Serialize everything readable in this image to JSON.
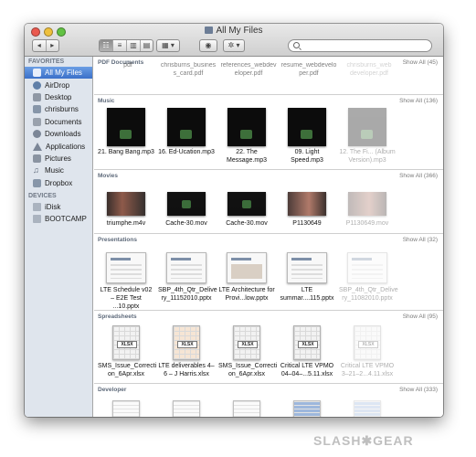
{
  "window": {
    "title": "All My Files"
  },
  "toolbar": {
    "back_forward": [
      "◂",
      "▸"
    ],
    "view_buttons": [
      "☷",
      "≡",
      "▥",
      "▤"
    ],
    "arrange_label": "▦ ▾",
    "quicklook_label": "◉",
    "action_label": "✲ ▾",
    "search_placeholder": ""
  },
  "sidebar": {
    "favorites_header": "FAVORITES",
    "favorites": [
      {
        "label": "All My Files",
        "icon": "all-files-icon",
        "selected": true
      },
      {
        "label": "AirDrop",
        "icon": "airdrop-icon"
      },
      {
        "label": "Desktop",
        "icon": "desktop-icon"
      },
      {
        "label": "chrisburns",
        "icon": "home-icon"
      },
      {
        "label": "Documents",
        "icon": "documents-icon"
      },
      {
        "label": "Downloads",
        "icon": "downloads-icon"
      },
      {
        "label": "Applications",
        "icon": "applications-icon"
      },
      {
        "label": "Pictures",
        "icon": "pictures-icon"
      },
      {
        "label": "Music",
        "icon": "music-icon"
      },
      {
        "label": "Dropbox",
        "icon": "dropbox-icon"
      }
    ],
    "devices_header": "DEVICES",
    "devices": [
      {
        "label": "iDisk",
        "icon": "idisk-icon"
      },
      {
        "label": "BOOTCAMP",
        "icon": "drive-icon"
      }
    ]
  },
  "sections": {
    "pdf": {
      "title": "PDF Documents",
      "show_all": "Show All (45)",
      "items": [
        "pdf",
        "chrisburns_busines s_card.pdf",
        "references_webdev eloper.pdf",
        "resume_webdevelo per.pdf",
        "chrisburns_web developer.pdf"
      ]
    },
    "music": {
      "title": "Music",
      "show_all": "Show All (136)",
      "items": [
        "21. Bang Bang.mp3",
        "16. Ed-Ucation.mp3",
        "22. The Message.mp3",
        "09. Light Speed.mp3",
        "12. The Fi... (Album Version).mp3"
      ]
    },
    "movies": {
      "title": "Movies",
      "show_all": "Show All (366)",
      "items": [
        "triumphe.m4v",
        "Cache-30.mov",
        "Cache-30.mov",
        "P1130649",
        "P1130649.mov"
      ]
    },
    "presentations": {
      "title": "Presentations",
      "show_all": "Show All (32)",
      "items": [
        "LTE Schedule v02 – E2E Test ...10.pptx",
        "SBP_4th_Qtr_Delive ry_11152010.pptx",
        "LTE Architecture for Provi...low.pptx",
        "LTE summar....115.pptx",
        "SBP_4th_Qtr_Delive ry_11082010.pptx"
      ]
    },
    "spreadsheets": {
      "title": "Spreadsheets",
      "show_all": "Show All (95)",
      "items": [
        "SMS_Issue_Correcti on_6Apr.xlsx",
        "LTE deliverables 4–6 – J Harris.xlsx",
        "SMS_Issue_Correcti on_6Apr.xlsx",
        "Critical LTE VPMO 04–04–...5.11.xlsx",
        "Critical LTE VPMO 3–21–2...4.11.xlsx"
      ],
      "badge": "XLSX"
    },
    "developer": {
      "title": "Developer",
      "show_all": "Show All (333)"
    }
  },
  "watermark": "SLASH✱GEAR"
}
